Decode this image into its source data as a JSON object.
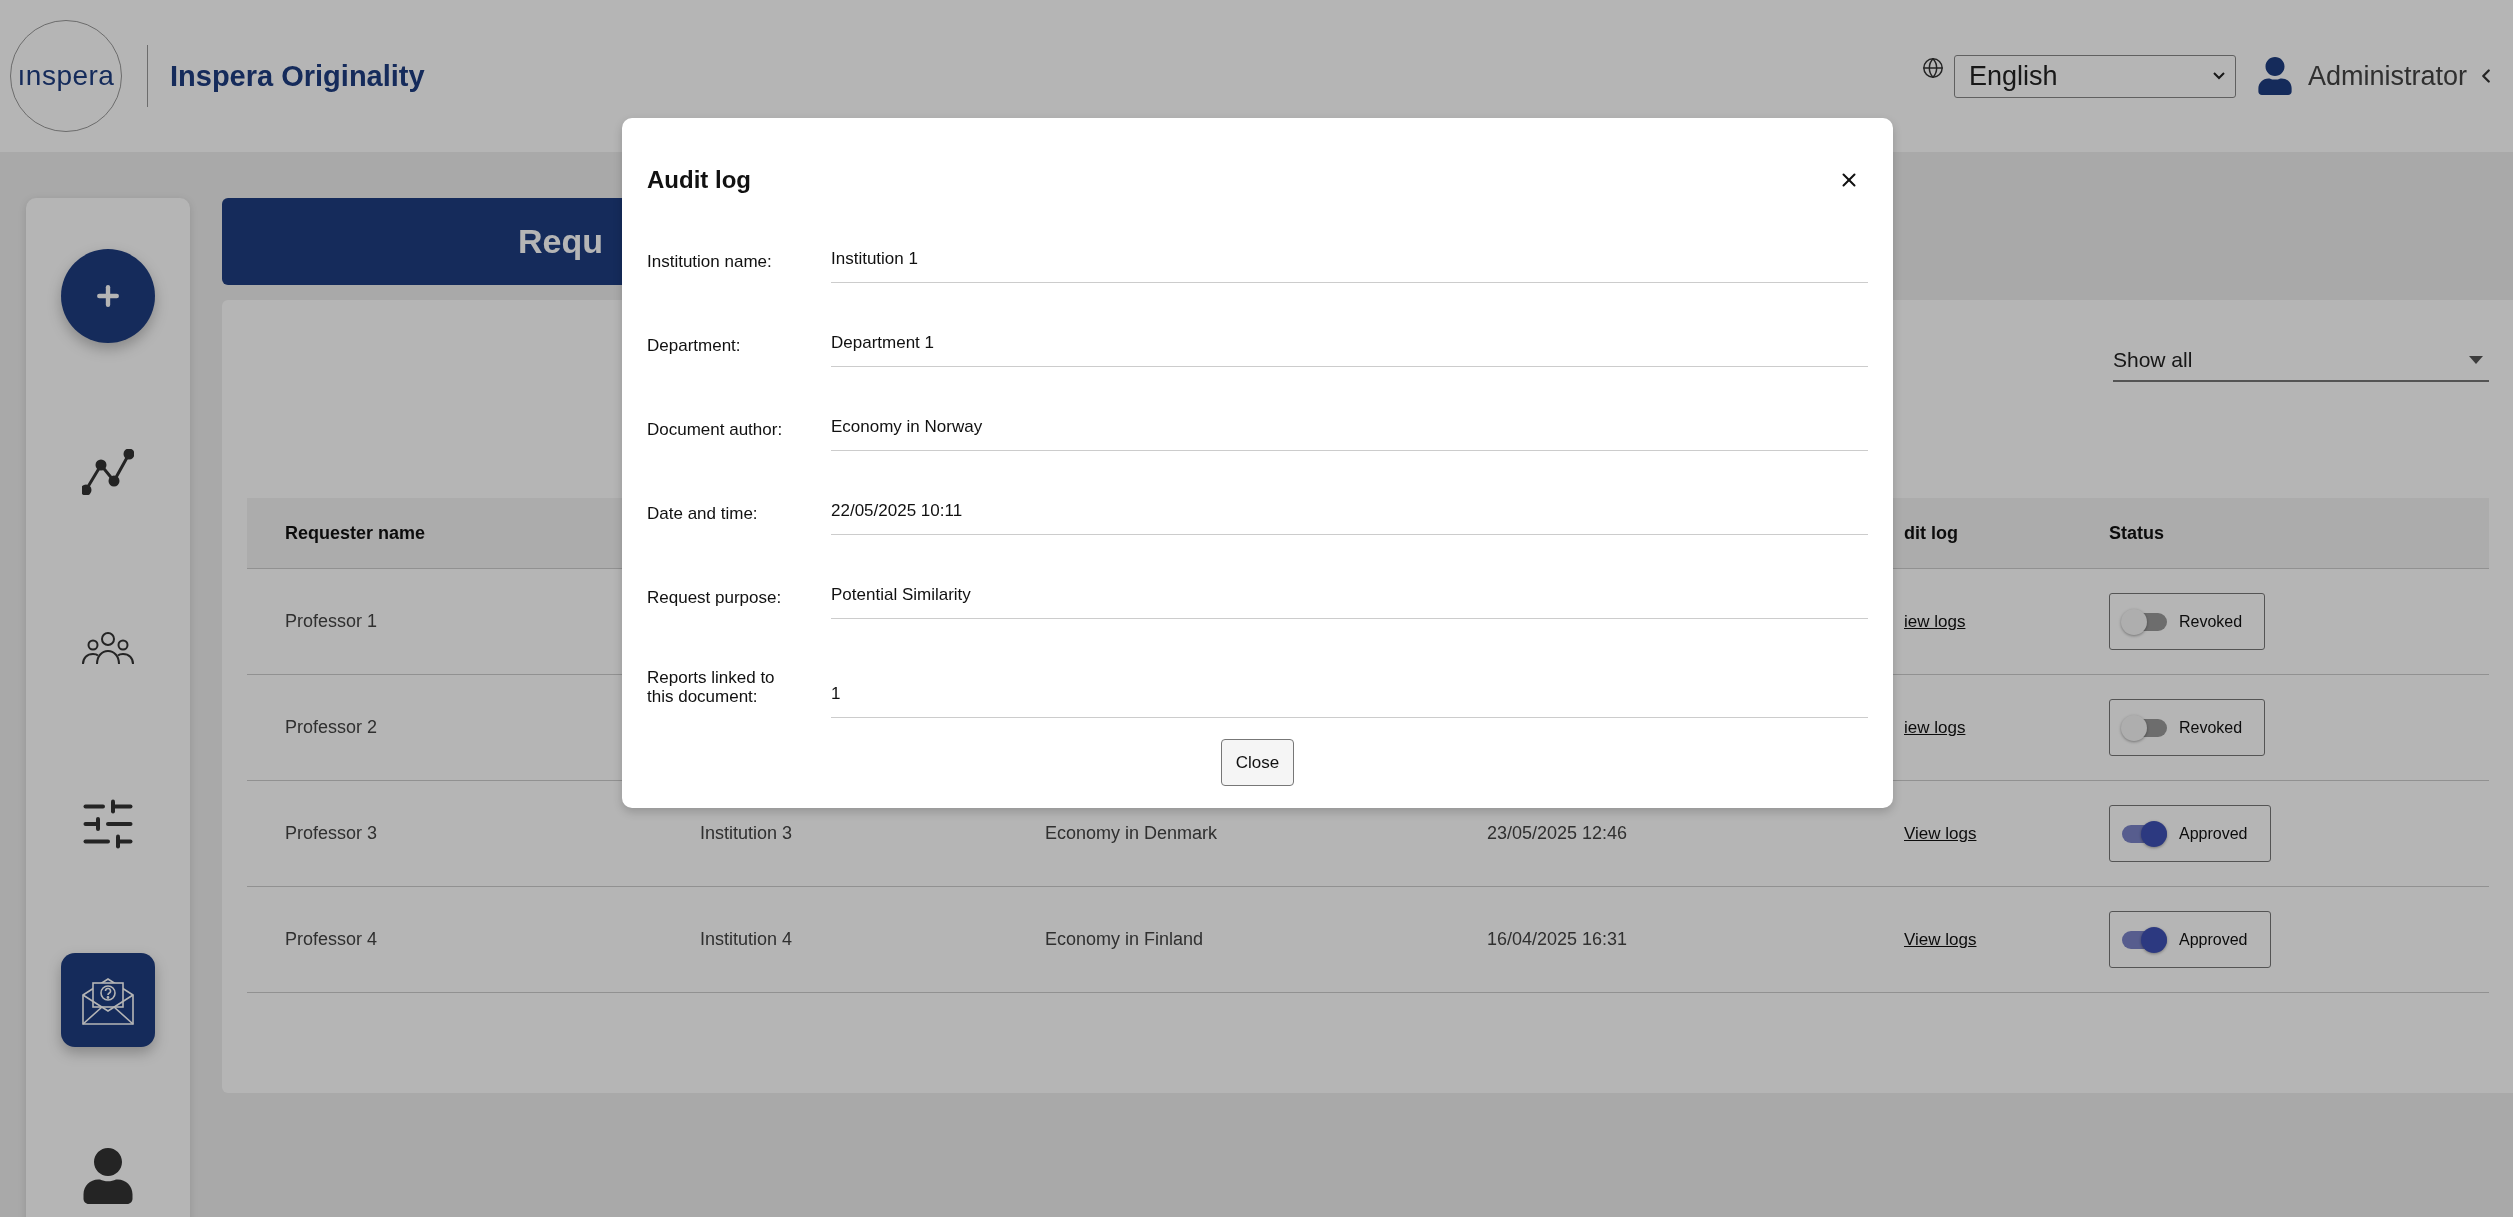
{
  "header": {
    "logo_text": "ınspera",
    "product_name": "Inspera Originality",
    "language": "English",
    "user_name": "Administrator"
  },
  "sidebar": {
    "items": [
      {
        "kind": "analytics",
        "selected": false
      },
      {
        "kind": "users",
        "selected": false
      },
      {
        "kind": "settings",
        "selected": false
      },
      {
        "kind": "requests",
        "selected": true
      },
      {
        "kind": "profile",
        "selected": false
      }
    ]
  },
  "banner": {
    "title": "Requ"
  },
  "filter": {
    "value": "Show all"
  },
  "table": {
    "columns": {
      "requester": "Requester name",
      "audit_log": "dit log",
      "status": "Status"
    },
    "rows": [
      {
        "requester": "Professor 1",
        "audit_link": "iew logs",
        "status": {
          "label": "Revoked",
          "on": false
        }
      },
      {
        "requester": "Professor 2",
        "audit_link": "iew logs",
        "status": {
          "label": "Revoked",
          "on": false
        }
      },
      {
        "requester": "Professor 3",
        "institution": "Institution 3",
        "document": "Economy in Denmark",
        "date": "23/05/2025 12:46",
        "audit_link": "View logs",
        "status": {
          "label": "Approved",
          "on": true
        }
      },
      {
        "requester": "Professor 4",
        "institution": "Institution 4",
        "document": "Economy in Finland",
        "date": "16/04/2025 16:31",
        "audit_link": "View logs",
        "status": {
          "label": "Approved",
          "on": true
        }
      }
    ]
  },
  "modal": {
    "title": "Audit log",
    "fields": [
      {
        "label": "Institution name:",
        "value": "Institution 1"
      },
      {
        "label": "Department:",
        "value": "Department 1"
      },
      {
        "label": "Document author:",
        "value": "Economy in Norway"
      },
      {
        "label": "Date and time:",
        "value": "22/05/2025 10:11"
      },
      {
        "label": "Request purpose:",
        "value": "Potential Similarity"
      },
      {
        "label": "Reports linked to this document:",
        "value": "1"
      }
    ],
    "close_label": "Close"
  }
}
